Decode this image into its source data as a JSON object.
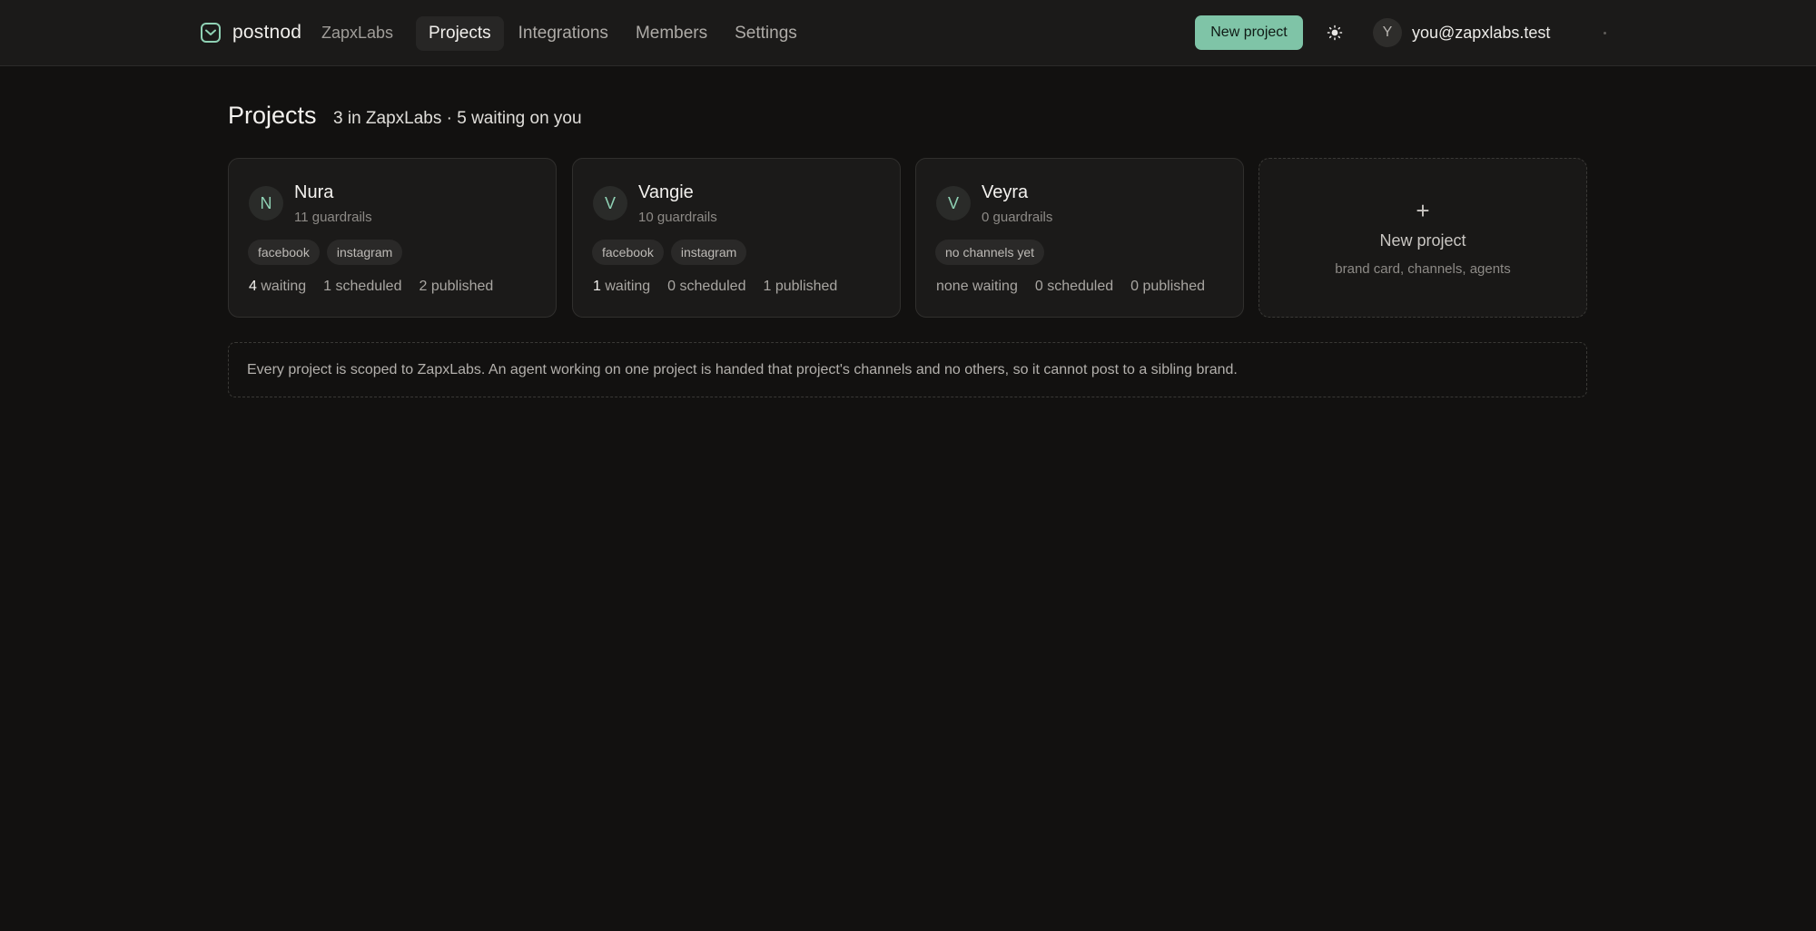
{
  "header": {
    "brand": "postnod",
    "org": "ZapxLabs",
    "nav": [
      {
        "label": "Projects",
        "active": true
      },
      {
        "label": "Integrations",
        "active": false
      },
      {
        "label": "Members",
        "active": false
      },
      {
        "label": "Settings",
        "active": false
      }
    ],
    "new_project_label": "New project",
    "theme_icon": "sun-icon",
    "user": {
      "initial": "Y",
      "email": "you@zapxlabs.test"
    }
  },
  "page": {
    "title": "Projects",
    "subtitle": "3 in ZapxLabs · 5 waiting on you"
  },
  "projects": [
    {
      "initial": "N",
      "name": "Nura",
      "guardrails": "11 guardrails",
      "channels": [
        "facebook",
        "instagram"
      ],
      "waiting_count": "4",
      "waiting_label": "waiting",
      "scheduled": "1 scheduled",
      "published": "2 published"
    },
    {
      "initial": "V",
      "name": "Vangie",
      "guardrails": "10 guardrails",
      "channels": [
        "facebook",
        "instagram"
      ],
      "waiting_count": "1",
      "waiting_label": "waiting",
      "scheduled": "0 scheduled",
      "published": "1 published"
    },
    {
      "initial": "V",
      "name": "Veyra",
      "guardrails": "0 guardrails",
      "channels": [
        "no channels yet"
      ],
      "waiting_count": "",
      "waiting_label": "none waiting",
      "scheduled": "0 scheduled",
      "published": "0 published"
    }
  ],
  "new_card": {
    "plus": "+",
    "title": "New project",
    "subtitle": "brand card, channels, agents"
  },
  "note": "Every project is scoped to ZapxLabs. An agent working on one project is handed that project's channels and no others, so it cannot post to a sibling brand.",
  "colors": {
    "accent": "#7fc4a7",
    "background": "#121110",
    "surface": "#1b1a19"
  }
}
